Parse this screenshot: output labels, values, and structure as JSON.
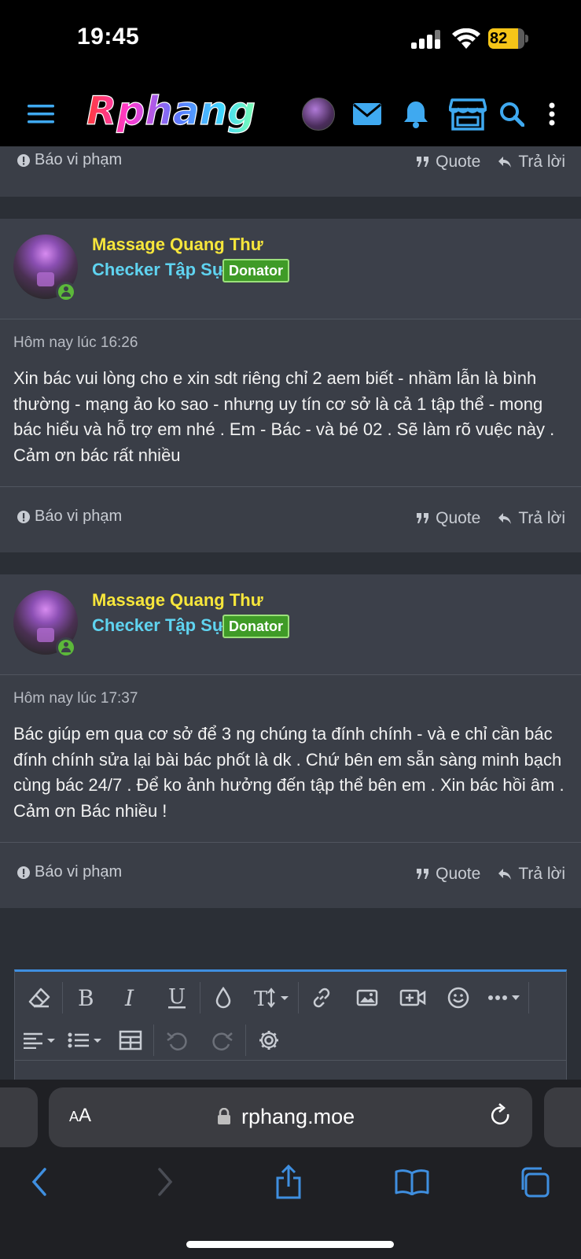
{
  "status_bar": {
    "time": "19:45",
    "battery": "82",
    "battery_level": 0.82
  },
  "site": {
    "logo_text": "Rphang"
  },
  "top_action_bar": {
    "report_label": "Báo vi phạm",
    "quote_label": "Quote",
    "reply_label": "Trả lời"
  },
  "posts": [
    {
      "author": "Massage Quang Thư",
      "user_title": "Checker Tập Sự",
      "badge": "Donator",
      "date": "Hôm nay lúc 16:26",
      "content": "Xin bác vui lòng cho e xin sdt riêng chỉ 2 aem biết - nhầm lẫn là bình thường - mạng ảo ko sao - nhưng uy tín cơ sở là cả 1 tập thể - mong bác hiểu và hỗ trợ em nhé . Em - Bác - và bé 02 . Sẽ làm rõ vuệc này . Cảm ơn bác rất nhiều",
      "report_label": "Báo vi phạm",
      "quote_label": "Quote",
      "reply_label": "Trả lời"
    },
    {
      "author": "Massage Quang Thư",
      "user_title": "Checker Tập Sự",
      "badge": "Donator",
      "date": "Hôm nay lúc 17:37",
      "content": "Bác giúp em qua cơ sở để 3 ng chúng ta đính chính - và e chỉ cần bác đính chính sửa lại bài bác phốt là dk . Chứ bên em sẵn sàng minh bạch cùng bác 24/7 . Để ko ảnh hưởng đến tập thể bên em . Xin bác hồi âm . Cảm ơn Bác nhiều !",
      "report_label": "Báo vi phạm",
      "quote_label": "Quote",
      "reply_label": "Trả lời"
    }
  ],
  "browser": {
    "aa_label_small": "A",
    "aa_label_big": "A",
    "host": "rphang.moe"
  },
  "colors": {
    "username": "#f7e63b",
    "usertitle": "#5fd3f0",
    "badge_bg": "#3f9b27",
    "accent": "#3f8fe0"
  }
}
